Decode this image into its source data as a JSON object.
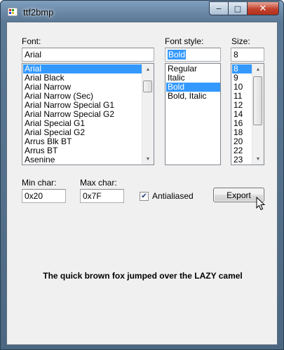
{
  "window": {
    "title": "ttf2bmp",
    "min_glyph": "−",
    "max_glyph": "□",
    "close_glyph": "✕"
  },
  "font": {
    "label": "Font:",
    "value": "Arial",
    "items": [
      "Arial",
      "Arial Black",
      "Arial Narrow",
      "Arial Narrow (Sec)",
      "Arial Narrow Special G1",
      "Arial Narrow Special G2",
      "Arial Special G1",
      "Arial Special G2",
      "Arrus Blk BT",
      "Arrus BT",
      "Asenine"
    ],
    "selected": "Arial"
  },
  "font_style": {
    "label": "Font style:",
    "value": "Bold",
    "items": [
      "Regular",
      "Italic",
      "Bold",
      "Bold, Italic"
    ],
    "selected": "Bold"
  },
  "size": {
    "label": "Size:",
    "value": "8",
    "items": [
      "8",
      "9",
      "10",
      "11",
      "12",
      "14",
      "16",
      "18",
      "20",
      "22",
      "23"
    ],
    "selected": "8"
  },
  "min_char": {
    "label": "Min char:",
    "value": "0x20"
  },
  "max_char": {
    "label": "Max char:",
    "value": "0x7F"
  },
  "antialiased": {
    "label": "Antialiased",
    "checked": true,
    "check_glyph": "✔"
  },
  "export_button": "Export",
  "scroll_glyphs": {
    "up": "▲",
    "down": "▼"
  },
  "preview_text": "The quick brown fox jumped over the LAZY camel"
}
